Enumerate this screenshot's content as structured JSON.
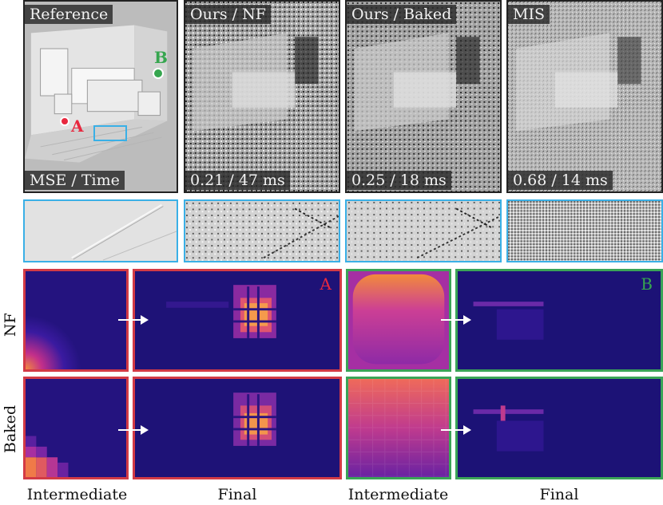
{
  "renders": [
    {
      "title": "Reference",
      "metric": "MSE / Time"
    },
    {
      "title": "Ours / NF",
      "metric": "0.21 / 47 ms"
    },
    {
      "title": "Ours / Baked",
      "metric": "0.25 / 18 ms"
    },
    {
      "title": "MIS",
      "metric": "0.68 / 14 ms"
    }
  ],
  "markers": {
    "a": "A",
    "b": "B"
  },
  "rows": {
    "nf": "NF",
    "baked": "Baked"
  },
  "columns": {
    "intermediate_1": "Intermediate",
    "final_1": "Final",
    "intermediate_2": "Intermediate",
    "final_2": "Final"
  },
  "colors": {
    "marker_a": "#e8283f",
    "marker_b": "#36a64f",
    "crop_border": "#3ab0e6",
    "heat_border_a": "#d33a45",
    "heat_border_b": "#3aa457"
  }
}
